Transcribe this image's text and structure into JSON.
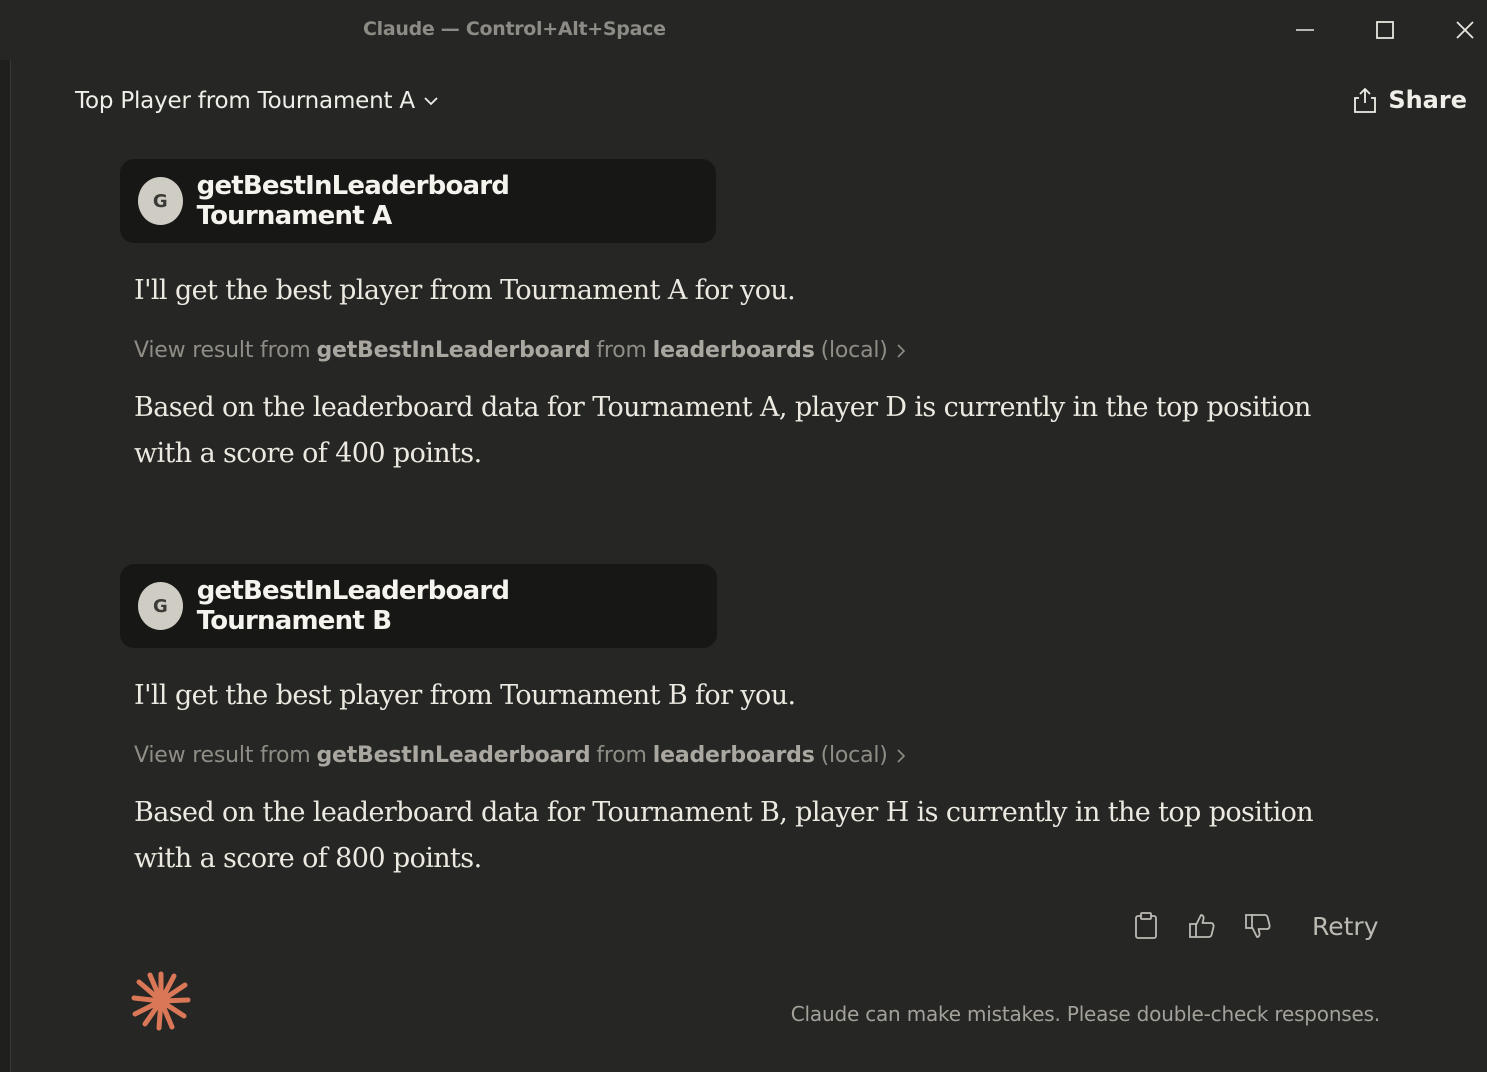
{
  "window": {
    "title": "Claude — Control+Alt+Space",
    "controls": [
      "minimize",
      "maximize",
      "close"
    ]
  },
  "header": {
    "conversation_title": "Top Player from Tournament A",
    "share_label": "Share"
  },
  "messages": [
    {
      "tool_avatar": "G",
      "tool_label": "getBestInLeaderboard Tournament A",
      "intro": "I'll get the best player from Tournament A for you.",
      "result_prefix": "View result from",
      "result_tool": "getBestInLeaderboard",
      "result_mid": "from",
      "result_server": "leaderboards",
      "result_suffix": "(local)",
      "answer": "Based on the leaderboard data for Tournament A, player D is currently in the top position with a score of 400 points."
    },
    {
      "tool_avatar": "G",
      "tool_label": "getBestInLeaderboard Tournament B",
      "intro": "I'll get the best player from Tournament B for you.",
      "result_prefix": "View result from",
      "result_tool": "getBestInLeaderboard",
      "result_mid": "from",
      "result_server": "leaderboards",
      "result_suffix": "(local)",
      "answer": "Based on the leaderboard data for Tournament B, player H is currently in the top position with a score of 800 points."
    }
  ],
  "actions": {
    "copy_icon": "clipboard-icon",
    "like_icon": "thumbs-up-icon",
    "dislike_icon": "thumbs-down-icon",
    "retry_label": "Retry"
  },
  "footer": {
    "disclaimer": "Claude can make mistakes. Please double-check responses.",
    "logo_color": "#d97757"
  }
}
